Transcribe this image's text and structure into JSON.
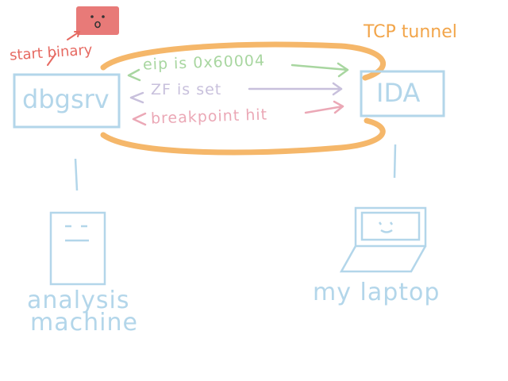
{
  "labels": {
    "tunnel": "TCP tunnel",
    "start_binary": "start binary",
    "dbgsrv": "dbgsrv",
    "ida": "IDA",
    "analysis_machine_line1": "analysis",
    "analysis_machine_line2": "machine",
    "my_laptop": "my laptop"
  },
  "messages": [
    {
      "text": "eip is 0x60004",
      "color": "#a8d6a0"
    },
    {
      "text": "ZF is set",
      "color": "#c8c0dc"
    },
    {
      "text": "breakpoint hit",
      "color": "#eba8b6"
    }
  ],
  "colors": {
    "tunnel": "#f5b76a",
    "tunnel_label": "#f2a54a",
    "box": "#b3d6ea",
    "start_binary": "#e66a62",
    "red_box": "#e87a78"
  },
  "icons": [
    "red-box-face-icon",
    "server-icon",
    "laptop-icon"
  ]
}
